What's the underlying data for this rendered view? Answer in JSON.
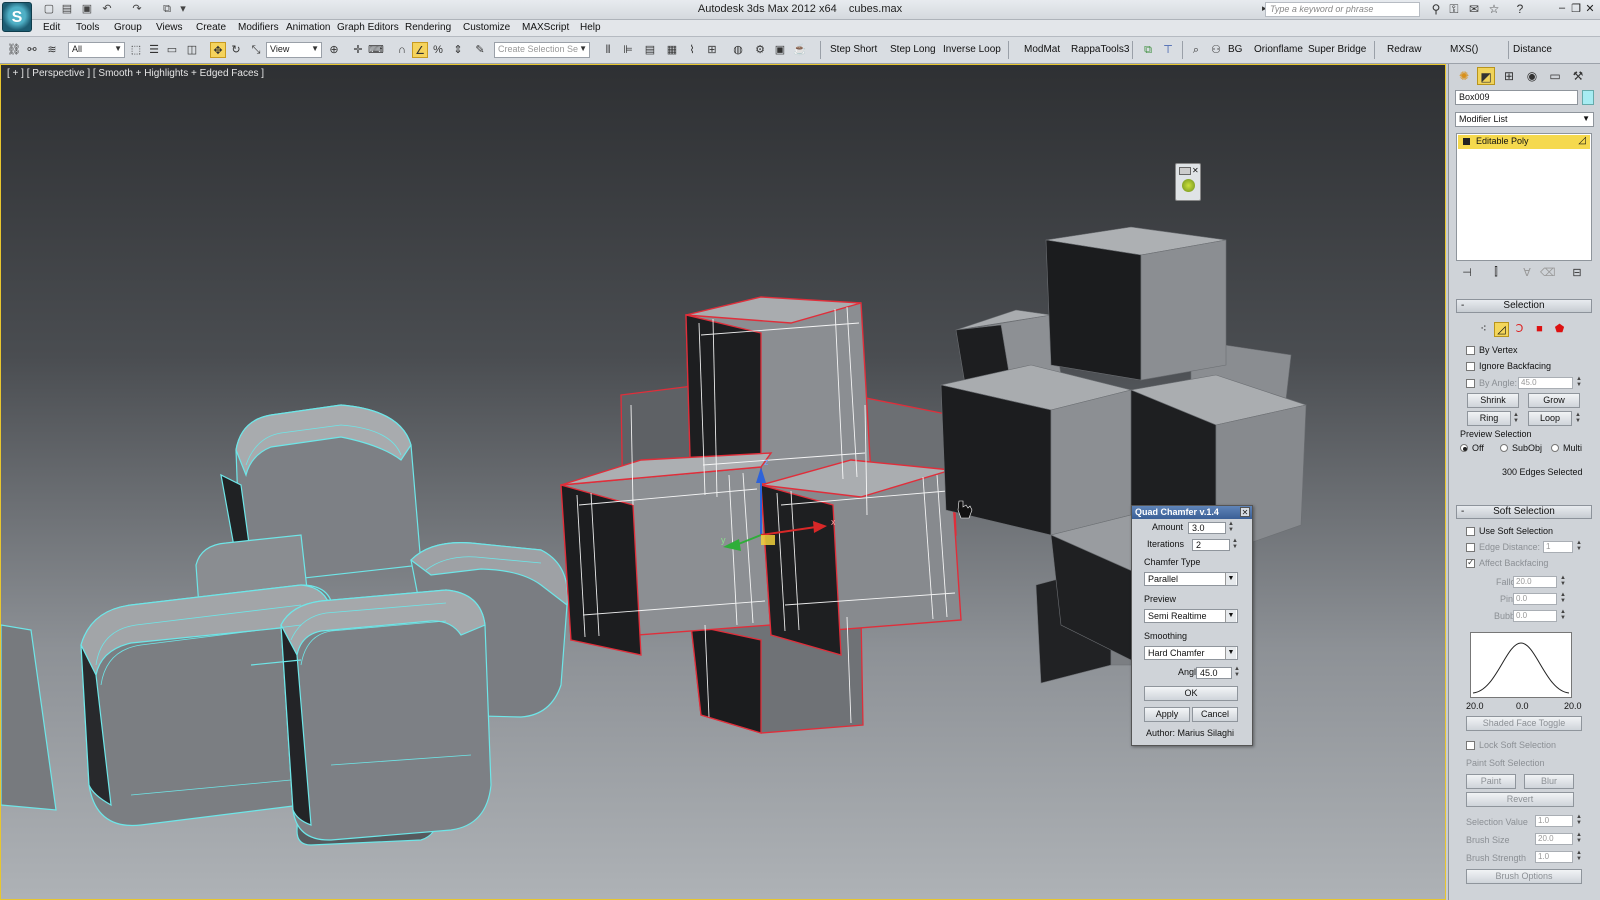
{
  "window": {
    "app_title": "Autodesk 3ds Max  2012 x64",
    "file_name": "cubes.max",
    "search_placeholder": "Type a keyword or phrase"
  },
  "menu": [
    "Edit",
    "Tools",
    "Group",
    "Views",
    "Create",
    "Modifiers",
    "Animation",
    "Graph Editors",
    "Rendering",
    "Customize",
    "MAXScript",
    "Help"
  ],
  "toolbar": {
    "filter_value": "All",
    "coord_value": "View",
    "selection_set_placeholder": "Create Selection Se",
    "buttons": [
      "Step Short",
      "Step Long",
      "Inverse Loop",
      "ModMat",
      "RappaTools3",
      "BG",
      "Orionflame",
      "Super Bridge",
      "Redraw",
      "MXS()",
      "Distance"
    ]
  },
  "viewport": {
    "label": "[ + ] [ Perspective ] [ Smooth + Highlights + Edged Faces ]",
    "gizmo_axes": {
      "x": "x",
      "y": "y",
      "z": "z"
    }
  },
  "command_panel": {
    "object_name": "Box009",
    "object_color": "#a7ecf2",
    "modifier_list": "Modifier List",
    "stack": [
      "Editable Poly"
    ],
    "selection": {
      "title": "Selection",
      "by_vertex": "By Vertex",
      "ignore_backfacing": "Ignore Backfacing",
      "by_angle": "By Angle:",
      "by_angle_value": "45.0",
      "shrink": "Shrink",
      "grow": "Grow",
      "ring": "Ring",
      "loop": "Loop",
      "preview_selection": "Preview Selection",
      "preview_off": "Off",
      "preview_subobj": "SubObj",
      "preview_multi": "Multi",
      "status": "300 Edges Selected"
    },
    "soft_selection": {
      "title": "Soft Selection",
      "use_soft_selection": "Use Soft Selection",
      "edge_distance": "Edge Distance:",
      "edge_distance_value": "1",
      "affect_backfacing": "Affect Backfacing",
      "falloff": "Falloff:",
      "falloff_value": "20.0",
      "pinch": "Pinch:",
      "pinch_value": "0.0",
      "bubble": "Bubble:",
      "bubble_value": "0.0",
      "graph_min": "20.0",
      "graph_mid": "0.0",
      "graph_max": "20.0",
      "shaded_face_toggle": "Shaded Face Toggle",
      "lock_soft_selection": "Lock Soft Selection",
      "paint_soft_selection": "Paint Soft Selection",
      "paint": "Paint",
      "blur": "Blur",
      "revert": "Revert",
      "selection_value": "Selection Value",
      "selection_value_value": "1.0",
      "brush_size": "Brush Size",
      "brush_size_value": "20.0",
      "brush_strength": "Brush Strength",
      "brush_strength_value": "1.0",
      "brush_options": "Brush Options"
    }
  },
  "quad_chamfer": {
    "title": "Quad Chamfer v.1.4",
    "amount_label": "Amount",
    "amount": "3.0",
    "iterations_label": "Iterations",
    "iterations": "2",
    "chamfer_type_label": "Chamfer Type",
    "chamfer_type": "Parallel",
    "preview_label": "Preview",
    "preview": "Semi Realtime",
    "smoothing_label": "Smoothing",
    "smoothing": "Hard Chamfer",
    "angle_label": "Angle",
    "angle": "45.0",
    "ok": "OK",
    "apply": "Apply",
    "cancel": "Cancel",
    "author": "Author: Marius Silaghi"
  }
}
